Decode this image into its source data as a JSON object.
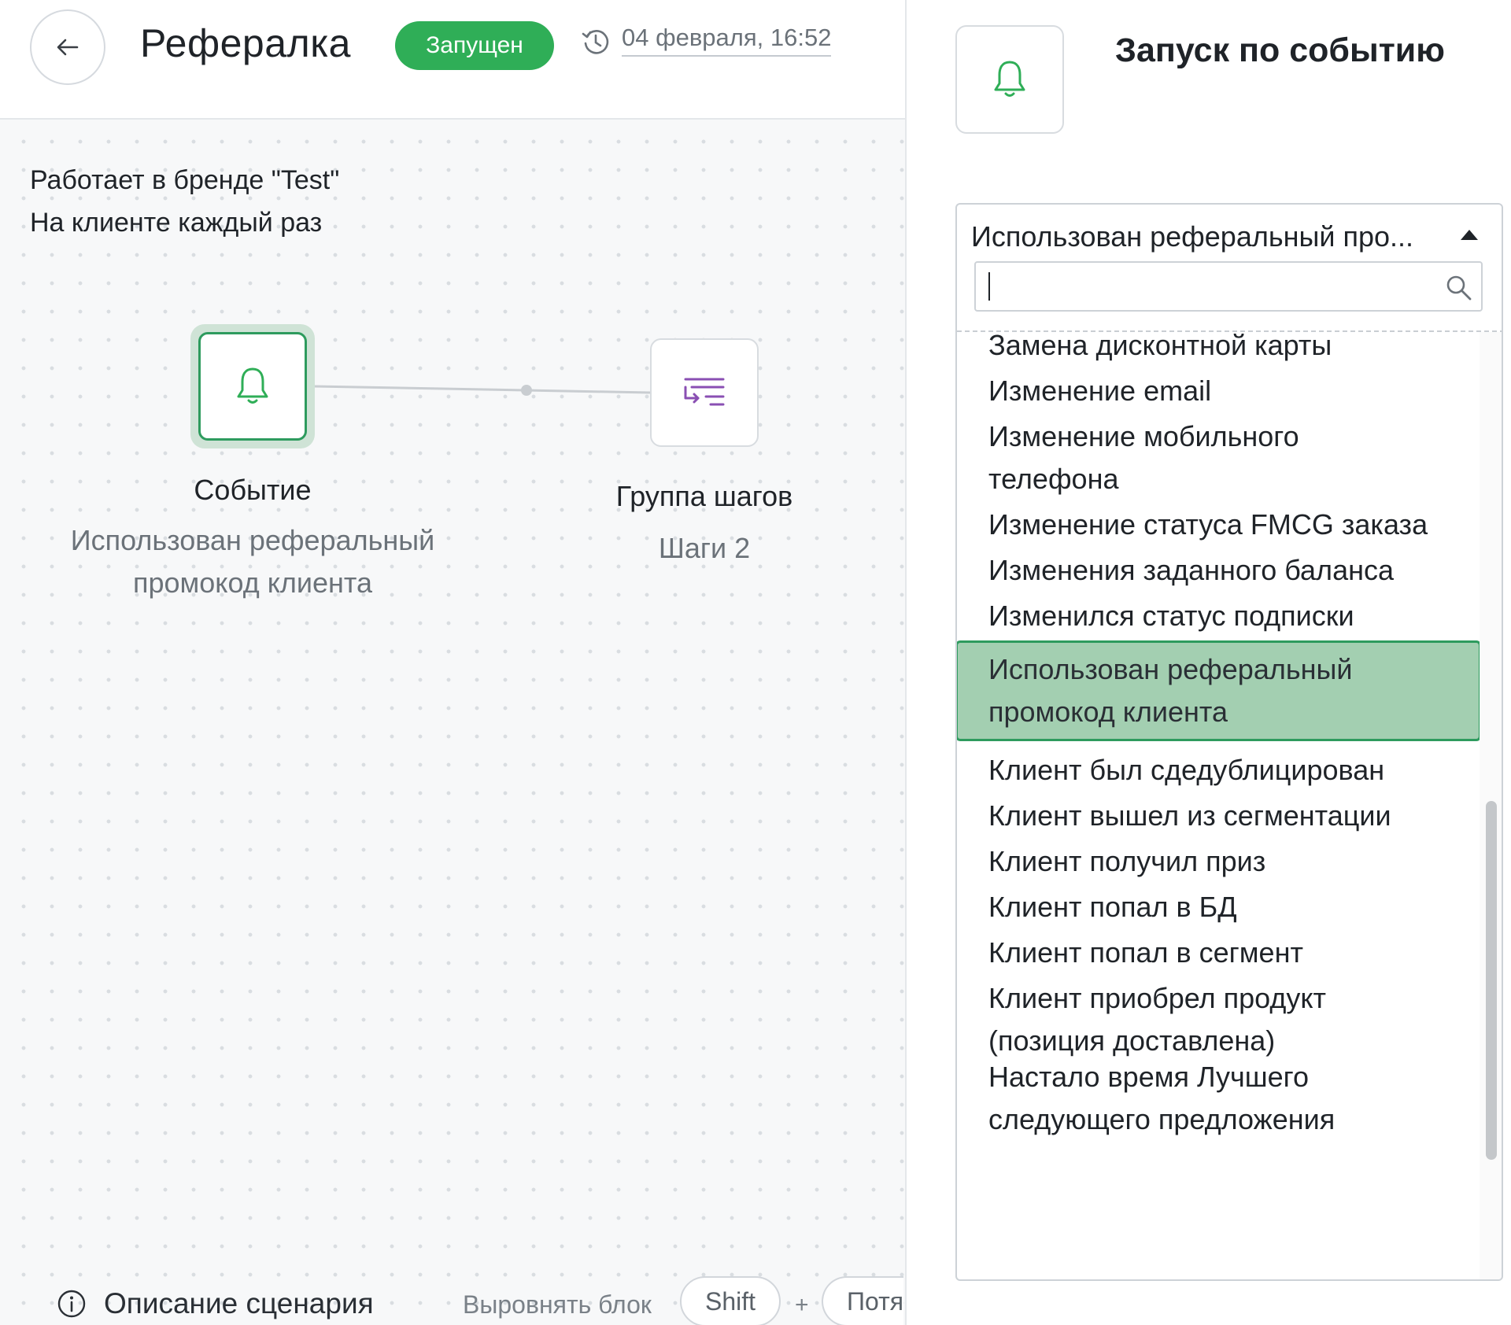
{
  "header": {
    "title": "Рефералка",
    "status": "Запущен",
    "history_date": "04 февраля, 16:52"
  },
  "info": {
    "line1": "Работает в бренде \"Test\"",
    "line2": "На клиенте каждый раз"
  },
  "nodes": {
    "event": {
      "title": "Событие",
      "subtitle_line1": "Использован реферальный",
      "subtitle_line2": "промокод клиента"
    },
    "steps": {
      "title": "Группа шагов",
      "subtitle": "Шаги 2"
    }
  },
  "footer": {
    "description_label": "Описание сценария",
    "hint_label": "Выровнять блок",
    "key_shift": "Shift",
    "plus": "+",
    "key_drag": "Потя"
  },
  "panel": {
    "title": "Запуск по событию",
    "dropdown": {
      "selected_value": "Использован реферальный про...",
      "search_value": "",
      "items": [
        {
          "line1": "Замена дисконтной карты",
          "line2": ""
        },
        {
          "line1": "Изменение email",
          "line2": ""
        },
        {
          "line1": "Изменение мобильного",
          "line2": "телефона"
        },
        {
          "line1": "Изменение статуса FMCG заказа",
          "line2": ""
        },
        {
          "line1": "Изменения заданного баланса",
          "line2": ""
        },
        {
          "line1": "Изменился статус подписки",
          "line2": ""
        },
        {
          "line1": "Использован реферальный",
          "line2": "промокод клиента"
        },
        {
          "line1": "Клиент был сдедублицирован",
          "line2": ""
        },
        {
          "line1": "Клиент вышел из сегментации",
          "line2": ""
        },
        {
          "line1": "Клиент получил приз",
          "line2": ""
        },
        {
          "line1": "Клиент попал в БД",
          "line2": ""
        },
        {
          "line1": "Клиент попал в сегмент",
          "line2": ""
        },
        {
          "line1": "Клиент приобрел продукт",
          "line2": "(позиция доставлена)"
        },
        {
          "line1": "Настало время Лучшего",
          "line2": "следующего предложения"
        }
      ]
    }
  },
  "icons": {
    "back": "arrow-left-icon",
    "history": "history-icon",
    "event": "bell-icon",
    "steps": "step-group-icon",
    "info": "info-icon",
    "search": "search-icon"
  },
  "colors": {
    "accent_green": "#2fae57",
    "selected_item_bg": "#a3cfb1",
    "steps_icon": "#8a4fb3"
  }
}
